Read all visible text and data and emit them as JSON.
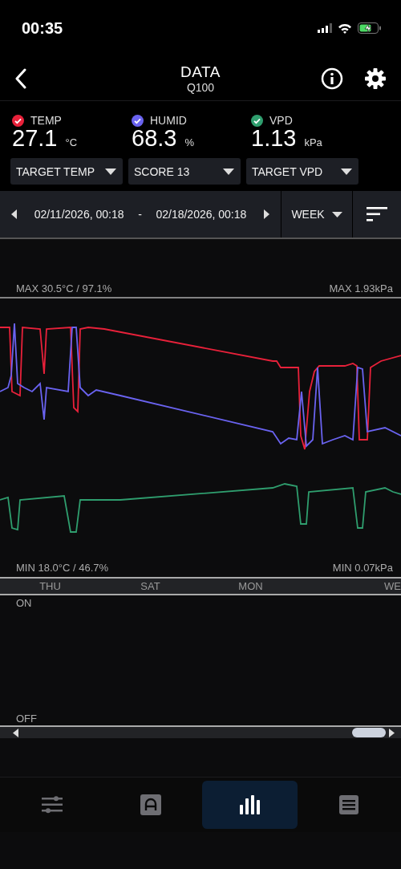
{
  "status_bar": {
    "time": "00:35"
  },
  "header": {
    "title": "DATA",
    "subtitle": "Q100"
  },
  "sensors": [
    {
      "name": "TEMP",
      "color": "#e8213a",
      "checked": true,
      "value": "27.1",
      "unit": "°C"
    },
    {
      "name": "HUMID",
      "color": "#6a63f0",
      "checked": true,
      "value": "68.3",
      "unit": "%"
    },
    {
      "name": "VPD",
      "color": "#2f9e6e",
      "checked": true,
      "value": "1.13",
      "unit": "kPa"
    }
  ],
  "dropdowns": [
    "TARGET TEMP",
    "SCORE 13",
    "TARGET VPD"
  ],
  "date_range": {
    "start": "02/11/2026, 00:18",
    "separator": "-",
    "end": "02/18/2026, 00:18",
    "period": "WEEK"
  },
  "chart": {
    "max_left": "MAX 30.5°C / 97.1%",
    "max_right": "MAX 1.93kPa",
    "min_left": "MIN 18.0°C / 46.7%",
    "min_right": "MIN 0.07kPa",
    "days": [
      "THU",
      "SAT",
      "MON",
      "WE"
    ],
    "on_label": "ON",
    "off_label": "OFF"
  },
  "nav": [
    {
      "kind": "sliders",
      "selected": false
    },
    {
      "kind": "mode",
      "selected": false
    },
    {
      "kind": "chart",
      "selected": true
    },
    {
      "kind": "list",
      "selected": false
    }
  ]
}
